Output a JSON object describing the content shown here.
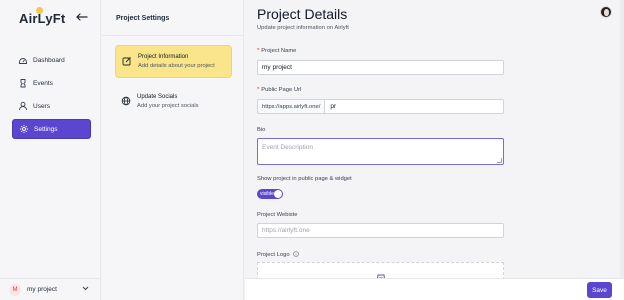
{
  "app": {
    "logo_text": "AirLyFt"
  },
  "sidebar": {
    "items": [
      {
        "label": "Dashboard",
        "icon": "dashboard-icon",
        "active": false
      },
      {
        "label": "Events",
        "icon": "events-icon",
        "active": false
      },
      {
        "label": "Users",
        "icon": "user-icon",
        "active": false
      },
      {
        "label": "Settings",
        "icon": "gear-icon",
        "active": true
      }
    ],
    "project_switcher": {
      "initial": "M",
      "name": "my project"
    }
  },
  "settings_menu": {
    "title": "Project Settings",
    "items": [
      {
        "title": "Project Information",
        "subtitle": "Add details about your project",
        "icon": "edit-icon",
        "active": true
      },
      {
        "title": "Update Socials",
        "subtitle": "Add your project socials",
        "icon": "globe-icon",
        "active": false
      }
    ]
  },
  "main": {
    "title": "Project Details",
    "subtitle": "Update project information on Airlyft",
    "fields": {
      "project_name": {
        "label": "Project Name",
        "required": "*",
        "value": "my project"
      },
      "public_url": {
        "label": "Public Page Url",
        "required": "*",
        "prefix": "https://apps.airlyft.one/",
        "value": "pr"
      },
      "bio": {
        "label": "Bio",
        "placeholder": "Event Description"
      },
      "visibility": {
        "label": "Show project in public page & widget",
        "toggle_text": "visible",
        "on": true
      },
      "website": {
        "label": "Project Webiste",
        "placeholder": "https://airlyft.one"
      },
      "logo": {
        "label": "Project Logo"
      }
    },
    "save_label": "Save"
  },
  "colors": {
    "accent": "#5b47cf",
    "highlight": "#fbe58b",
    "required": "#e02424"
  }
}
